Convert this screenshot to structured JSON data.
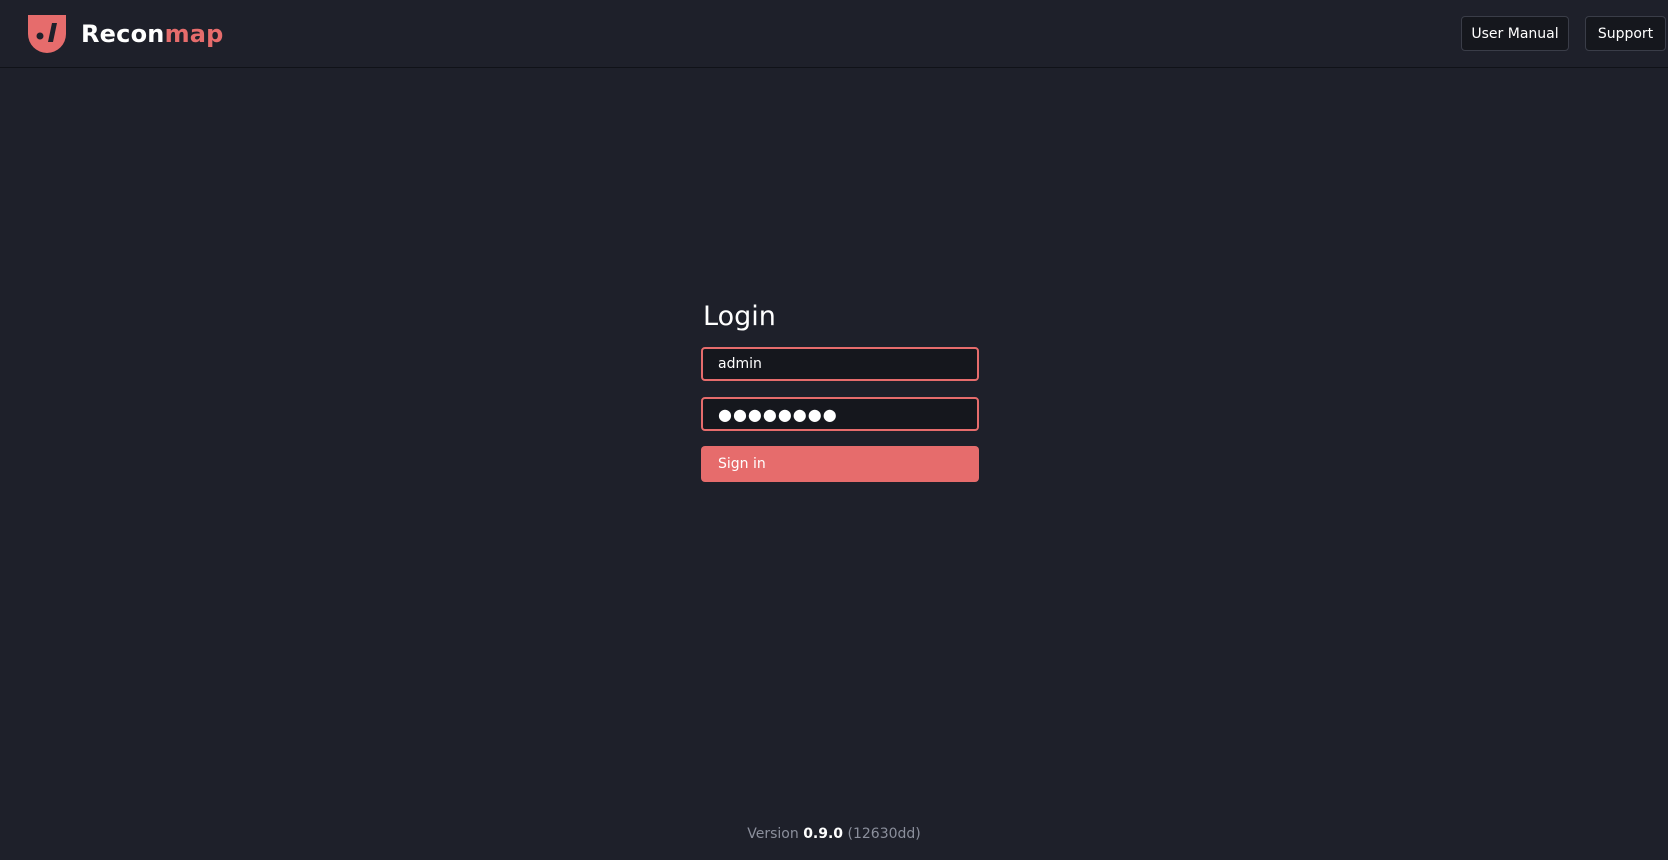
{
  "app": {
    "name_part1": "Recon",
    "name_part2": "map",
    "logo_icon": "reconmap-shield-icon",
    "accent_color": "#e66c6c"
  },
  "nav": {
    "user_manual_label": "User Manual",
    "support_label": "Support"
  },
  "login": {
    "title": "Login",
    "username_value": "admin",
    "password_value": "●●●●●●●●",
    "submit_label": "Sign in"
  },
  "footer": {
    "version_label": "Version",
    "version_number": "0.9.0",
    "commit": "(12630dd)"
  }
}
